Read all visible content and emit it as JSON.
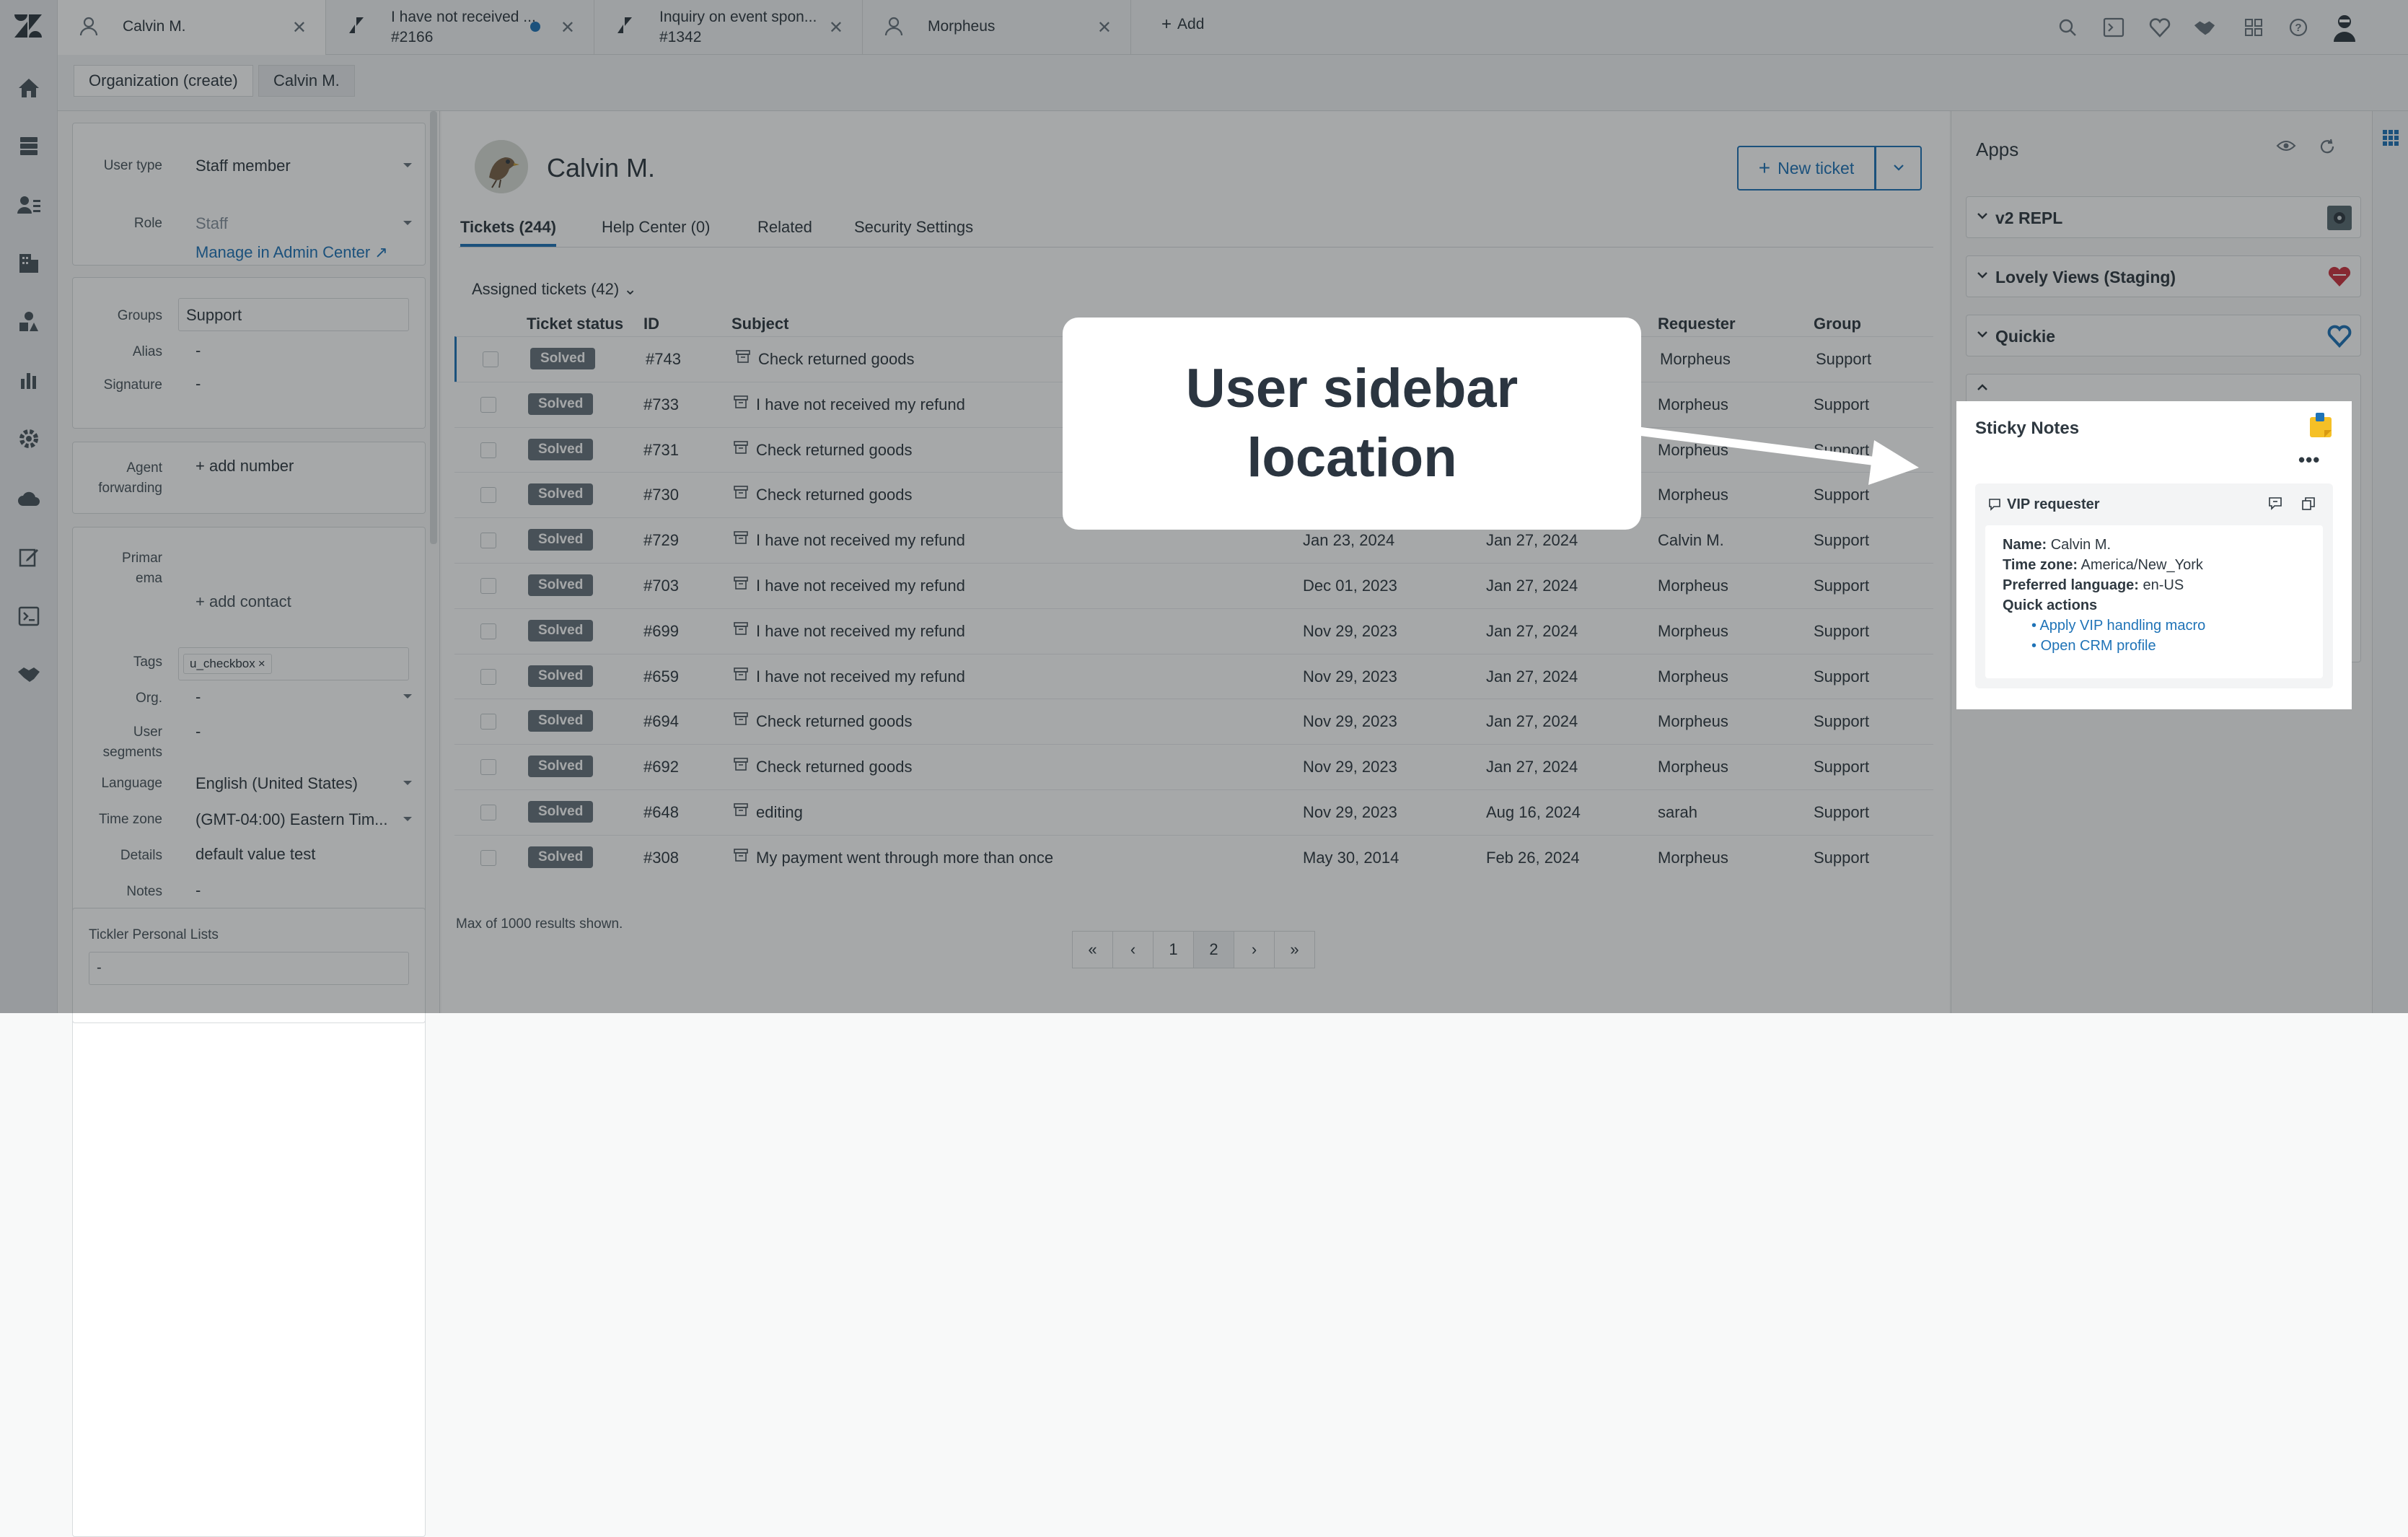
{
  "tabs": [
    {
      "title": "Calvin M.",
      "icon": "user-icon"
    },
    {
      "title": "I have not received ...",
      "sub": "#2166",
      "icon": "ticket-icon",
      "unread": true
    },
    {
      "title": "Inquiry on event spon...",
      "sub": "#1342",
      "icon": "ticket-icon"
    },
    {
      "title": "Morpheus",
      "icon": "user-icon"
    }
  ],
  "add_tab": "Add",
  "breadcrumbs": [
    "Organization (create)",
    "Calvin M."
  ],
  "user_fields": {
    "user_type_label": "User type",
    "user_type": "Staff member",
    "role_label": "Role",
    "role": "Staff",
    "role_link": "Manage in Admin Center",
    "groups_label": "Groups",
    "groups": "Support",
    "alias_label": "Alias",
    "alias": "-",
    "signature_label": "Signature",
    "signature": "-",
    "agent_forwarding_label": "Agent forwarding",
    "agent_forwarding": "+ add number",
    "primary_email_label_1": "Primar",
    "primary_email_label_2": "ema",
    "add_contact": "+ add contact",
    "tags_label": "Tags",
    "tag": "u_checkbox",
    "org_label": "Org.",
    "org": "-",
    "segments_label": "User segments",
    "segments": "-",
    "language_label": "Language",
    "language": "English (United States)",
    "timezone_label": "Time zone",
    "timezone": "(GMT-04:00) Eastern Tim...",
    "details_label": "Details",
    "details": "default value test",
    "notes_label": "Notes",
    "notes": "-",
    "tickler_label": "Tickler Personal Lists",
    "tickler": "-"
  },
  "main": {
    "user_name": "Calvin M.",
    "new_ticket": "New ticket",
    "tabs": [
      "Tickets (244)",
      "Help Center (0)",
      "Related",
      "Security Settings"
    ],
    "assigned": "Assigned tickets (42)",
    "columns": [
      "Ticket status",
      "ID",
      "Subject",
      "Requester",
      "Group"
    ],
    "rows": [
      {
        "status": "Solved",
        "id": "#743",
        "subject": "Check returned goods",
        "created": "",
        "updated": "",
        "requester": "Morpheus",
        "group": "Support"
      },
      {
        "status": "Solved",
        "id": "#733",
        "subject": "I have not received my refund",
        "created": "",
        "updated": "",
        "requester": "Morpheus",
        "group": "Support"
      },
      {
        "status": "Solved",
        "id": "#731",
        "subject": "Check returned goods",
        "created": "",
        "updated": "",
        "requester": "Morpheus",
        "group": "Support"
      },
      {
        "status": "Solved",
        "id": "#730",
        "subject": "Check returned goods",
        "created": "",
        "updated": "",
        "requester": "Morpheus",
        "group": "Support"
      },
      {
        "status": "Solved",
        "id": "#729",
        "subject": "I have not received my refund",
        "created": "Jan 23, 2024",
        "updated": "Jan 27, 2024",
        "requester": "Calvin M.",
        "group": "Support"
      },
      {
        "status": "Solved",
        "id": "#703",
        "subject": "I have not received my refund",
        "created": "Dec 01, 2023",
        "updated": "Jan 27, 2024",
        "requester": "Morpheus",
        "group": "Support"
      },
      {
        "status": "Solved",
        "id": "#699",
        "subject": "I have not received my refund",
        "created": "Nov 29, 2023",
        "updated": "Jan 27, 2024",
        "requester": "Morpheus",
        "group": "Support"
      },
      {
        "status": "Solved",
        "id": "#659",
        "subject": "I have not received my refund",
        "created": "Nov 29, 2023",
        "updated": "Jan 27, 2024",
        "requester": "Morpheus",
        "group": "Support"
      },
      {
        "status": "Solved",
        "id": "#694",
        "subject": "Check returned goods",
        "created": "Nov 29, 2023",
        "updated": "Jan 27, 2024",
        "requester": "Morpheus",
        "group": "Support"
      },
      {
        "status": "Solved",
        "id": "#692",
        "subject": "Check returned goods",
        "created": "Nov 29, 2023",
        "updated": "Jan 27, 2024",
        "requester": "Morpheus",
        "group": "Support"
      },
      {
        "status": "Solved",
        "id": "#648",
        "subject": "editing",
        "created": "Nov 29, 2023",
        "updated": "Aug 16, 2024",
        "requester": "sarah",
        "group": "Support"
      },
      {
        "status": "Solved",
        "id": "#308",
        "subject": "My payment went through more than once",
        "created": "May 30, 2014",
        "updated": "Feb 26, 2024",
        "requester": "Morpheus",
        "group": "Support"
      }
    ],
    "max_results": "Max of 1000 results shown.",
    "pager": [
      "«",
      "‹",
      "1",
      "2",
      "›",
      "»"
    ]
  },
  "callout": "User sidebar location",
  "apps": {
    "title": "Apps",
    "items": [
      "v2 REPL",
      "Lovely Views (Staging)",
      "Quickie"
    ],
    "sticky_title": "Sticky Notes",
    "note_title": "VIP requester",
    "name_label": "Name:",
    "name": "Calvin M.",
    "tz_label": "Time zone:",
    "tz": "America/New_York",
    "lang_label": "Preferred language:",
    "lang": "en-US",
    "qa_label": "Quick actions",
    "actions": [
      "Apply VIP handling macro",
      "Open CRM profile"
    ]
  },
  "colors": {
    "accent": "#1f73b7",
    "badge": "#68737d",
    "unread_dot": "#1f73b7"
  }
}
